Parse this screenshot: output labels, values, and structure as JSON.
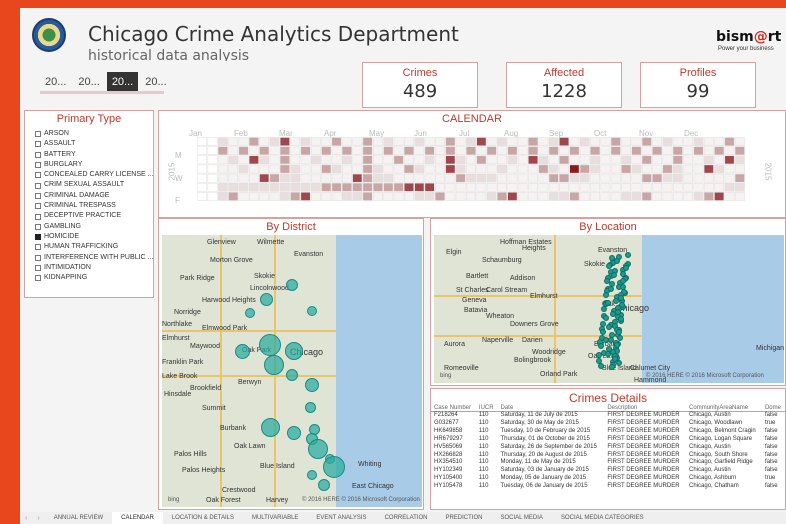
{
  "header": {
    "title": "Chicago Crime Analytics Department",
    "subtitle": "historical data analysis",
    "brand": {
      "name_prefix": "bism",
      "name_at": "@",
      "name_suffix": "rt",
      "tagline": "Power your business"
    }
  },
  "year_buttons": [
    {
      "label": "20...",
      "selected": false
    },
    {
      "label": "20...",
      "selected": false
    },
    {
      "label": "20...",
      "selected": true
    },
    {
      "label": "20...",
      "selected": false
    }
  ],
  "kpis": [
    {
      "label": "Crimes",
      "value": "489"
    },
    {
      "label": "Affected",
      "value": "1228"
    },
    {
      "label": "Profiles",
      "value": "99"
    }
  ],
  "primary_type": {
    "title": "Primary Type",
    "items": [
      {
        "label": "ARSON",
        "checked": false
      },
      {
        "label": "ASSAULT",
        "checked": false
      },
      {
        "label": "BATTERY",
        "checked": false
      },
      {
        "label": "BURGLARY",
        "checked": false
      },
      {
        "label": "CONCEALED CARRY LICENSE ...",
        "checked": false
      },
      {
        "label": "CRIM SEXUAL ASSAULT",
        "checked": false
      },
      {
        "label": "CRIMINAL DAMAGE",
        "checked": false
      },
      {
        "label": "CRIMINAL TRESPASS",
        "checked": false
      },
      {
        "label": "DECEPTIVE PRACTICE",
        "checked": false
      },
      {
        "label": "GAMBLING",
        "checked": false
      },
      {
        "label": "HOMICIDE",
        "checked": true
      },
      {
        "label": "HUMAN TRAFFICKING",
        "checked": false
      },
      {
        "label": "INTERFERENCE WITH PUBLIC ...",
        "checked": false
      },
      {
        "label": "INTIMIDATION",
        "checked": false
      },
      {
        "label": "KIDNAPPING",
        "checked": false
      }
    ]
  },
  "calendar": {
    "title": "CALENDAR",
    "months": [
      "Jan",
      "Feb",
      "Mar",
      "Apr",
      "May",
      "Jun",
      "Jul",
      "Aug",
      "Sep",
      "Oct",
      "Nov",
      "Dec"
    ],
    "day_labels": [
      "M",
      "W",
      "F"
    ],
    "year_label": "2015",
    "colors": {
      "low": "#e9dede",
      "mid": "#c9a5a5",
      "high": "#a0474d",
      "peak": "#8b1a1f"
    }
  },
  "district_map": {
    "title": "By District",
    "places": [
      "Glenview",
      "Wilmette",
      "Morton Grove",
      "Evanston",
      "Park Ridge",
      "Skokie",
      "Lincolnwood",
      "Harwood Heights",
      "Norridge",
      "Elmwood Park",
      "Oak Park",
      "Maywood",
      "Chicago",
      "Berwyn",
      "Brookfield",
      "Hinsdale",
      "Summit",
      "Burbank",
      "Oak Lawn",
      "Palos Hills",
      "Palos Heights",
      "Blue Island",
      "Crestwood",
      "Oak Forest",
      "Harvey",
      "Whiting",
      "East Chicago",
      "Lake Brook",
      "Elmhurst",
      "Franklin Park",
      "Northlake"
    ],
    "credits": "© 2016 HERE  © 2016 Microsoft Corporation",
    "bing_label": "bing"
  },
  "location_map": {
    "title": "By Location",
    "places": [
      "Hoffman Estates",
      "Elgin",
      "Schaumburg",
      "Bartlett",
      "Addison",
      "St Charles",
      "Carol Stream",
      "Elmhurst",
      "Geneva",
      "Batavia",
      "Wheaton",
      "Downers Grove",
      "Aurora",
      "Naperville",
      "Darien",
      "Woodridge",
      "Bolingbrook",
      "Romeoville",
      "Orland Park",
      "Oak Lawn",
      "Blue Island",
      "Calumet City",
      "Hammond",
      "Burbank",
      "Evanston",
      "Skokie",
      "Chicago",
      "Oak",
      "Heights",
      "Michigan C"
    ],
    "credits": "© 2016 HERE  © 2016 Microsoft Corporation",
    "bing_label": "bing"
  },
  "crimes_details": {
    "title": "Crimes Details",
    "columns": [
      "Case Number",
      "IUCR",
      "Date",
      "Description",
      "CommunityAreaName",
      "Dome"
    ],
    "rows": [
      [
        "F218264",
        "110",
        "Saturday, 11 de July de 2015",
        "FIRST DEGREE MURDER",
        "Chicago, Austin",
        "false"
      ],
      [
        "G032677",
        "110",
        "Saturday, 30 de May de 2015",
        "FIRST DEGREE MURDER",
        "Chicago, Woodlawn",
        "true"
      ],
      [
        "HK649858",
        "110",
        "Tuesday, 10 de February de 2015",
        "FIRST DEGREE MURDER",
        "Chicago, Belmont Cragin",
        "false"
      ],
      [
        "HR679297",
        "110",
        "Thursday, 01 de October de 2015",
        "FIRST DEGREE MURDER",
        "Chicago, Logan Square",
        "false"
      ],
      [
        "HV565069",
        "110",
        "Saturday, 26 de September de 2015",
        "FIRST DEGREE MURDER",
        "Chicago, Austin",
        "false"
      ],
      [
        "HX266828",
        "110",
        "Thursday, 20 de August de 2015",
        "FIRST DEGREE MURDER",
        "Chicago, South Shore",
        "false"
      ],
      [
        "HX354510",
        "110",
        "Monday, 11 de May de 2015",
        "FIRST DEGREE MURDER",
        "Chicago, Garfield Ridge",
        "false"
      ],
      [
        "HY102349",
        "110",
        "Saturday, 03 de January de 2015",
        "FIRST DEGREE MURDER",
        "Chicago, Austin",
        "false"
      ],
      [
        "HY105400",
        "110",
        "Monday, 05 de January de 2015",
        "FIRST DEGREE MURDER",
        "Chicago, Ashburn",
        "true"
      ],
      [
        "HY105478",
        "110",
        "Tuesday, 06 de January de 2015",
        "FIRST DEGREE MURDER",
        "Chicago, Chatham",
        "false"
      ]
    ]
  },
  "tabs": [
    {
      "label": "ANNUAL REVIEW",
      "active": false
    },
    {
      "label": "CALENDAR",
      "active": true
    },
    {
      "label": "LOCATION & DETAILS",
      "active": false
    },
    {
      "label": "MULTIVARIABLE",
      "active": false
    },
    {
      "label": "EVENT ANALYSIS",
      "active": false
    },
    {
      "label": "CORRELATION",
      "active": false
    },
    {
      "label": "PREDICTION",
      "active": false
    },
    {
      "label": "SOCIAL MEDIA",
      "active": false
    },
    {
      "label": "SOCIAL MEDIA CATEGORIES",
      "active": false
    }
  ]
}
